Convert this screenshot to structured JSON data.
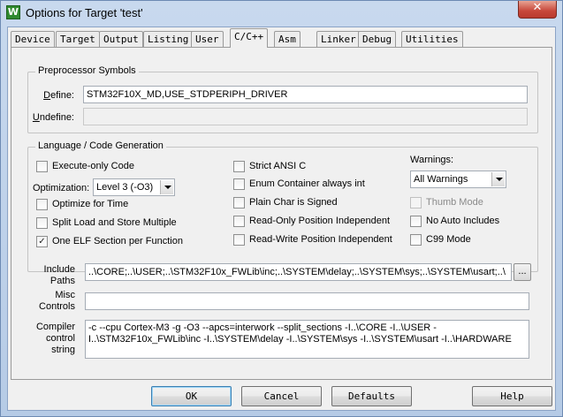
{
  "window": {
    "title": "Options for Target 'test'",
    "app_icon": "W",
    "close_glyph": "✕",
    "icon_color": "#2f8a2f"
  },
  "tabs": [
    {
      "label": "Device"
    },
    {
      "label": "Target"
    },
    {
      "label": "Output"
    },
    {
      "label": "Listing"
    },
    {
      "label": "User"
    },
    {
      "label": "C/C++",
      "active": true
    },
    {
      "label": "Asm"
    },
    {
      "label": "Linker"
    },
    {
      "label": "Debug"
    },
    {
      "label": "Utilities"
    }
  ],
  "preprocessor": {
    "group_label": "Preprocessor Symbols",
    "define_label": "Define:",
    "define_value": "STM32F10X_MD,USE_STDPERIPH_DRIVER",
    "undefine_label": "Undefine:",
    "undefine_value": ""
  },
  "language": {
    "group_label": "Language / Code Generation",
    "execute_only": {
      "label": "Execute-only Code",
      "checked": false
    },
    "optimization_label": "Optimization:",
    "optimization_value": "Level 3 (-O3)",
    "optimize_time": {
      "label": "Optimize for Time",
      "checked": false
    },
    "split_load": {
      "label": "Split Load and Store Multiple",
      "checked": false
    },
    "one_elf": {
      "label": "One ELF Section per Function",
      "checked": true
    },
    "strict_ansi": {
      "label": "Strict ANSI C",
      "checked": false
    },
    "enum_container": {
      "label": "Enum Container always int",
      "checked": false
    },
    "plain_char": {
      "label": "Plain Char is Signed",
      "checked": false
    },
    "ro_position": {
      "label": "Read-Only Position Independent",
      "checked": false
    },
    "rw_position": {
      "label": "Read-Write Position Independent",
      "checked": false
    },
    "warnings_label": "Warnings:",
    "warnings_value": "All Warnings",
    "thumb_mode": {
      "label": "Thumb Mode",
      "checked": false,
      "disabled": true
    },
    "no_auto_includes": {
      "label": "No Auto Includes",
      "checked": false
    },
    "c99_mode": {
      "label": "C99 Mode",
      "checked": false
    },
    "check_glyph": "✓"
  },
  "include_paths": {
    "label_line1": "Include",
    "label_line2": "Paths",
    "value": "..\\CORE;..\\USER;..\\STM32F10x_FWLib\\inc;..\\SYSTEM\\delay;..\\SYSTEM\\sys;..\\SYSTEM\\usart;..\\",
    "browse_label": "..."
  },
  "misc_controls": {
    "label_line1": "Misc",
    "label_line2": "Controls",
    "value": ""
  },
  "compiler_string": {
    "label_line1": "Compiler",
    "label_line2": "control",
    "label_line3": "string",
    "value": "-c --cpu Cortex-M3 -g -O3 --apcs=interwork --split_sections -I..\\CORE -I..\\USER -I..\\STM32F10x_FWLib\\inc -I..\\SYSTEM\\delay -I..\\SYSTEM\\sys -I..\\SYSTEM\\usart -I..\\HARDWARE"
  },
  "buttons": {
    "ok": "OK",
    "cancel": "Cancel",
    "defaults": "Defaults",
    "help": "Help"
  }
}
